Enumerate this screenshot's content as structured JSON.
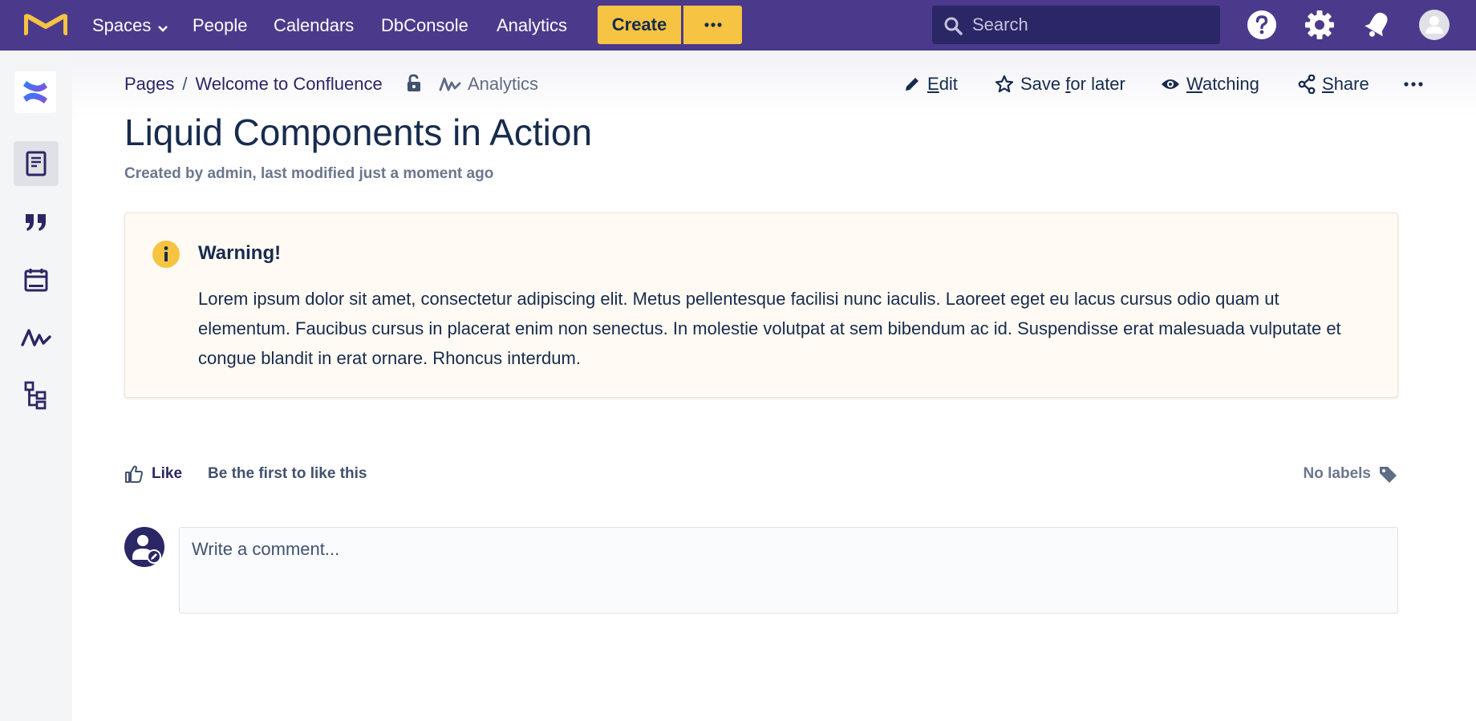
{
  "topnav": {
    "items": [
      {
        "label": "Spaces",
        "has_caret": true
      },
      {
        "label": "People"
      },
      {
        "label": "Calendars"
      },
      {
        "label": "DbConsole"
      },
      {
        "label": "Analytics"
      }
    ],
    "create_label": "Create",
    "more_label": "···",
    "search_placeholder": "Search",
    "colors": {
      "bar": "#4b3a8c",
      "create": "#f6c342",
      "search": "#2b2665"
    },
    "icons": [
      "help-icon",
      "settings-icon",
      "notifications-icon",
      "user-avatar-icon"
    ]
  },
  "sidebar": {
    "icons": [
      "confluence-space-logo",
      "pages-icon",
      "blog-quote-icon",
      "calendar-icon",
      "analytics-icon",
      "page-tree-icon"
    ],
    "active": "pages-icon"
  },
  "breadcrumb": {
    "items": [
      "Pages",
      "Welcome to Confluence"
    ],
    "separator": "/"
  },
  "header": {
    "analytics_label": "Analytics",
    "actions": [
      {
        "name": "edit",
        "before": "",
        "accel": "E",
        "after": "dit"
      },
      {
        "name": "save-for-later",
        "before": "Save ",
        "accel": "f",
        "after": "or later"
      },
      {
        "name": "watching",
        "before": "",
        "accel": "W",
        "after": "atching"
      },
      {
        "name": "share",
        "before": "",
        "accel": "S",
        "after": "hare"
      }
    ],
    "more_label": "···"
  },
  "page": {
    "title": "Liquid Components in Action",
    "meta": "Created by admin, last modified just a moment ago"
  },
  "warning": {
    "title": "Warning!",
    "body": "Lorem ipsum dolor sit amet, consectetur adipiscing elit. Metus pellentesque facilisi nunc iaculis. Laoreet eget eu lacus cursus odio quam ut elementum. Faucibus cursus in placerat enim non senectus. In molestie volutpat at sem bibendum ac id. Suspendisse erat malesuada vulputate et congue blandit in erat ornare. Rhoncus interdum.",
    "accent": "#f6c342",
    "background": "#fffaf3"
  },
  "likes": {
    "like_label": "Like",
    "like_text": "Be the first to like this",
    "labels_text": "No labels"
  },
  "comment": {
    "placeholder": "Write a comment..."
  }
}
